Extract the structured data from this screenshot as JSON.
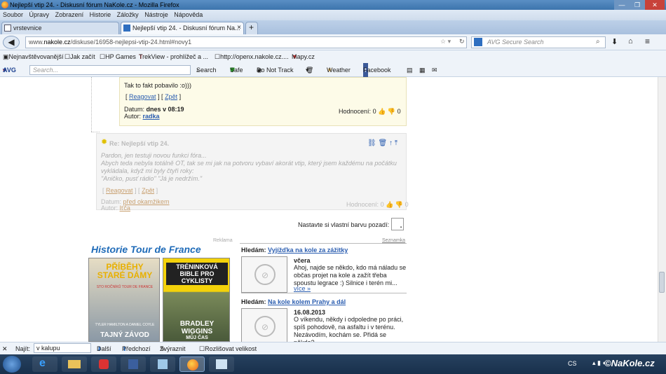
{
  "window": {
    "title": "Nejlepší vtip 24. - Diskusní fórum NaKole.cz - Mozilla Firefox"
  },
  "menu": [
    "Soubor",
    "Úpravy",
    "Zobrazení",
    "Historie",
    "Záložky",
    "Nástroje",
    "Nápověda"
  ],
  "tabs": [
    {
      "label": "vrstevnice"
    },
    {
      "label": "Nejlepší vtip 24. - Diskusní fórum Na..."
    }
  ],
  "address": {
    "prefix": "www.",
    "domain": "nakole.cz",
    "path": "/diskuse/16958-nejlepsi-vtip-24.html#novy1"
  },
  "avg_search_placeholder": "AVG Secure Search",
  "bookmarks": [
    "Nejnavštěvovanější",
    "Jak začít",
    "HP Games",
    "TrekView - prohlížeč a ...",
    "http://openx.nakole.cz....",
    "Mapy.cz"
  ],
  "avg_toolbar": {
    "logo": "AVG",
    "search_placeholder": "Search...",
    "search_button": "Search",
    "safe": "Safe",
    "dnt": "Do Not Track",
    "weather": "Weather",
    "facebook": "Facebook"
  },
  "post1": {
    "text": "Tak to fakt pobavilo :o)))",
    "reply": "Reagovat",
    "back": "Zpět",
    "date_label": "Datum:",
    "date": "dnes v 08:19",
    "author_label": "Autor:",
    "author": "radka",
    "rating_label": "Hodnocení:",
    "rating_up": "0",
    "rating_down": "0"
  },
  "post2": {
    "title": "Re: Nejlepší vtip 24.",
    "line1": "Pardon, jen testuji novou funkci fóra...",
    "line2": "Abych teda nebyla totálně OT, tak se mi jak na potvoru vybaví akorát vtip, který jsem každému na počátku",
    "line3": "vykládala, když mi byly čtyři roky:",
    "line4": "\"Aničko, pusť rádio\" \"Já je nedržím.\"",
    "reply": "Reagovat",
    "back": "Zpět",
    "date_label": "Datum:",
    "date": "před okamžikem",
    "author_label": "Autor:",
    "author": "Iťča",
    "rating_label": "Hodnocení:",
    "rating_up": "0",
    "rating_down": "0"
  },
  "color_picker_label": "Nastavte si vlastní barvu pozadí:",
  "ad": {
    "label": "Reklama",
    "headline": "Historie Tour de France",
    "book1_title": "PŘÍBĚHY STARÉ DÁMY",
    "book1_sub": "STO ROČNÍKŮ TOUR DE FRANCE",
    "book1_authors": "TYLER HAMILTON A DANIEL COYLE",
    "book1_bottom": "TAJNÝ ZÁVOD",
    "book2_title": "TRÉNINKOVÁ BIBLE PRO CYKLISTY",
    "book2_bottom": "BRADLEY WIGGINS",
    "book2_extra": "MŮJ ČAS"
  },
  "seznamka": {
    "header": "Seznamka",
    "items": [
      {
        "label": "Hledám:",
        "title": "Vyjížďka na kole za zážitky",
        "date": "včera",
        "text": "Ahoj, najde se někdo, kdo má náladu se občas projet na kole a zažít třeba spoustu legrace :) Silnice i terén mi...",
        "more": "více »"
      },
      {
        "label": "Hledám:",
        "title": "Na kole kolem Prahy a dál",
        "date": "16.08.2013",
        "text": "O víkendu, někdy i odpoledne po práci, spíš pohodově, na asfaltu i v terénu. Nezávodím, kochám se. Přidá se někdo?",
        "more": ""
      }
    ]
  },
  "findbar": {
    "label": "Najít:",
    "value": "v kalupu",
    "next": "Další",
    "prev": "Předchozí",
    "highlight": "Zvýraznit",
    "matchcase": "Rozlišovat velikost"
  },
  "taskbar": {
    "lang": "CS",
    "watermark": "©NaKole.cz"
  }
}
